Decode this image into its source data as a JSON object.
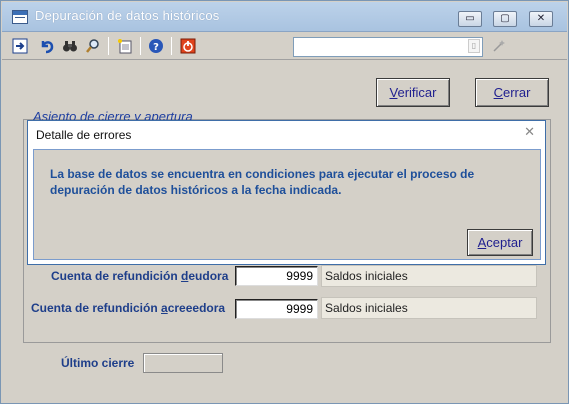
{
  "window": {
    "title": "Depuración de datos históricos",
    "minimize_glyph": "▭",
    "maximize_glyph": "▢",
    "close_glyph": "✕"
  },
  "toolbar": {
    "icons": [
      "exit-icon",
      "undo-icon",
      "binoculars-icon",
      "magnifier-icon",
      "new-document-icon",
      "help-icon",
      "power-icon"
    ],
    "search_value": ""
  },
  "buttons": {
    "verificar": {
      "prefix": "",
      "underline": "V",
      "rest": "erificar"
    },
    "cerrar": {
      "prefix": "",
      "underline": "C",
      "rest": "errar"
    },
    "aceptar": {
      "prefix": "",
      "underline": "A",
      "rest": "ceptar"
    }
  },
  "group": {
    "label": "Asiento de cierre y apertura"
  },
  "dialog": {
    "title": "Detalle de errores",
    "message": "La base de datos se encuentra en condiciones para ejecutar el proceso de depuración de datos históricos a la fecha indicada."
  },
  "fields": {
    "deudora": {
      "label_pre": "Cuenta de refundición ",
      "label_u": "d",
      "label_post": "eudora",
      "value": "9999",
      "desc": "Saldos iniciales"
    },
    "acreedora": {
      "label_pre": "Cuenta de refundición ",
      "label_u": "a",
      "label_post": "creeedora",
      "value": "9999",
      "desc": "Saldos iniciales"
    },
    "ultimo_cierre": {
      "label": "Último cierre",
      "value": ""
    }
  },
  "colors": {
    "title_bar": "#bcd2ea",
    "label_blue": "#1e3e8a",
    "dialog_border": "#3f6ea8"
  }
}
